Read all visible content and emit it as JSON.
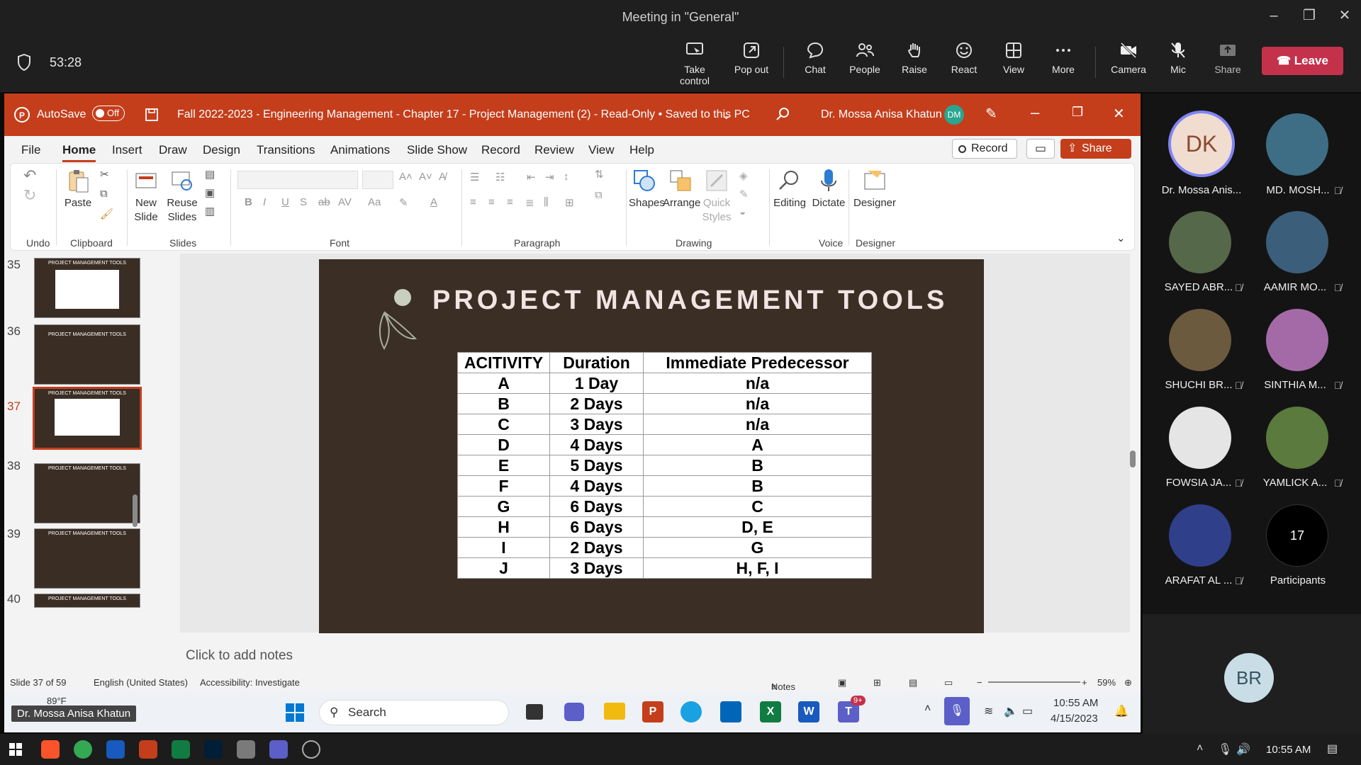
{
  "window": {
    "title": "Meeting in \"General\""
  },
  "meeting": {
    "elapsed": "53:28",
    "buttons": [
      "Take control",
      "Pop out",
      "Chat",
      "People",
      "Raise",
      "React",
      "View",
      "More",
      "Camera",
      "Mic",
      "Share"
    ],
    "leave_label": "Leave"
  },
  "ppt": {
    "autosave_label": "AutoSave",
    "autosave_state": "Off",
    "doc_title": "Fall 2022-2023 - Engineering Management - Chapter 17 - Project Management (2)  -  Read-Only  •  Saved to this PC",
    "user": "Dr. Mossa Anisa Khatun",
    "user_initials": "DM",
    "tabs": [
      "File",
      "Home",
      "Insert",
      "Draw",
      "Design",
      "Transitions",
      "Animations",
      "Slide Show",
      "Record",
      "Review",
      "View",
      "Help"
    ],
    "record_label": "Record",
    "share_label": "Share",
    "ribbon": {
      "paste": "Paste",
      "new_slide": "New Slide",
      "reuse_slides": "Reuse Slides",
      "shapes": "Shapes",
      "arrange": "Arrange",
      "quick_styles": "Quick Styles",
      "editing": "Editing",
      "dictate": "Dictate",
      "designer": "Designer",
      "groups": [
        "Undo",
        "Clipboard",
        "Slides",
        "Font",
        "Paragraph",
        "Drawing",
        "Voice",
        "Designer"
      ]
    },
    "thumbnails": [
      {
        "num": "35",
        "title": "PROJECT MANAGEMENT TOOLS"
      },
      {
        "num": "36",
        "title": "PROJECT MANAGEMENT TOOLS"
      },
      {
        "num": "37",
        "title": "PROJECT MANAGEMENT TOOLS"
      },
      {
        "num": "38",
        "title": "PROJECT MANAGEMENT TOOLS"
      },
      {
        "num": "39",
        "title": "PROJECT MANAGEMENT TOOLS"
      },
      {
        "num": "40",
        "title": "PROJECT MANAGEMENT TOOLS"
      }
    ],
    "slide": {
      "title": "PROJECT MANAGEMENT TOOLS",
      "table_headers": [
        "ACITIVITY",
        "Duration",
        "Immediate Predecessor"
      ],
      "table_rows": [
        [
          "A",
          "1 Day",
          "n/a"
        ],
        [
          "B",
          "2 Days",
          "n/a"
        ],
        [
          "C",
          "3 Days",
          "n/a"
        ],
        [
          "D",
          "4 Days",
          "A"
        ],
        [
          "E",
          "5 Days",
          "B"
        ],
        [
          "F",
          "4 Days",
          "B"
        ],
        [
          "G",
          "6 Days",
          "C"
        ],
        [
          "H",
          "6 Days",
          "D, E"
        ],
        [
          "I",
          "2 Days",
          "G"
        ],
        [
          "J",
          "3 Days",
          "H, F, I"
        ]
      ]
    },
    "notes_placeholder": "Click to add notes",
    "status": {
      "slide": "Slide 37 of 59",
      "language": "English (United States)",
      "accessibility": "Accessibility: Investigate",
      "notes": "Notes",
      "zoom": "59%"
    }
  },
  "taskbar": {
    "weather": "89°F",
    "presenter": "Dr. Mossa Anisa Khatun",
    "search": "Search",
    "time": "10:55 AM",
    "date": "4/15/2023",
    "teams_badge": "9+"
  },
  "participants": [
    {
      "name": "Dr. Mossa Anis...",
      "initials": "DK"
    },
    {
      "name": "MD. MOSH..."
    },
    {
      "name": "SAYED ABR..."
    },
    {
      "name": "AAMIR MO..."
    },
    {
      "name": "SHUCHI BR..."
    },
    {
      "name": "SINTHIA M..."
    },
    {
      "name": "FOWSIA JA..."
    },
    {
      "name": "YAMLICK A..."
    },
    {
      "name": "ARAFAT AL ..."
    },
    {
      "name": "Participants",
      "count": "17"
    }
  ],
  "self_initials": "BR",
  "wintask_time": "10:55 AM"
}
